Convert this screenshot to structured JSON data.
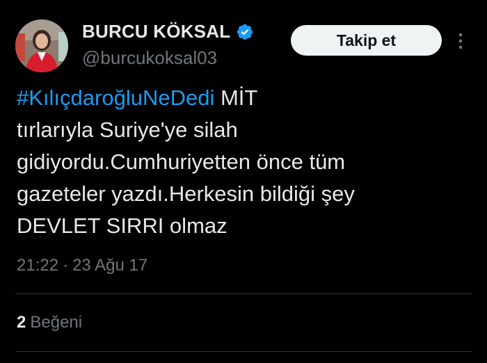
{
  "author": {
    "display_name": "BURCU KÖKSAL",
    "handle": "@burcukoksal03",
    "verified": true,
    "avatar_icon": "profile-photo"
  },
  "actions": {
    "follow_label": "Takip et",
    "more_icon": "more-vertical-icon"
  },
  "tweet": {
    "hashtag": "#KılıçdaroğluNeDedi",
    "line1_rest": " MİT",
    "line2": "tırlarıyla Suriye'ye silah",
    "line3": "gidiyordu.Cumhuriyetten önce tüm",
    "line4": "gazeteler yazdı.Herkesin bildiği şey",
    "line5": "DEVLET SIRRI olmaz"
  },
  "meta": {
    "time": "21:22",
    "separator": "·",
    "date": "23 Ağu 17"
  },
  "stats": {
    "likes_count": "2",
    "likes_label": "Beğeni"
  },
  "colors": {
    "background": "#000000",
    "text": "#e7e9ea",
    "secondary": "#71767b",
    "link": "#1d9bf0",
    "verified": "#1d9bf0",
    "button_bg": "#eff3f4"
  }
}
